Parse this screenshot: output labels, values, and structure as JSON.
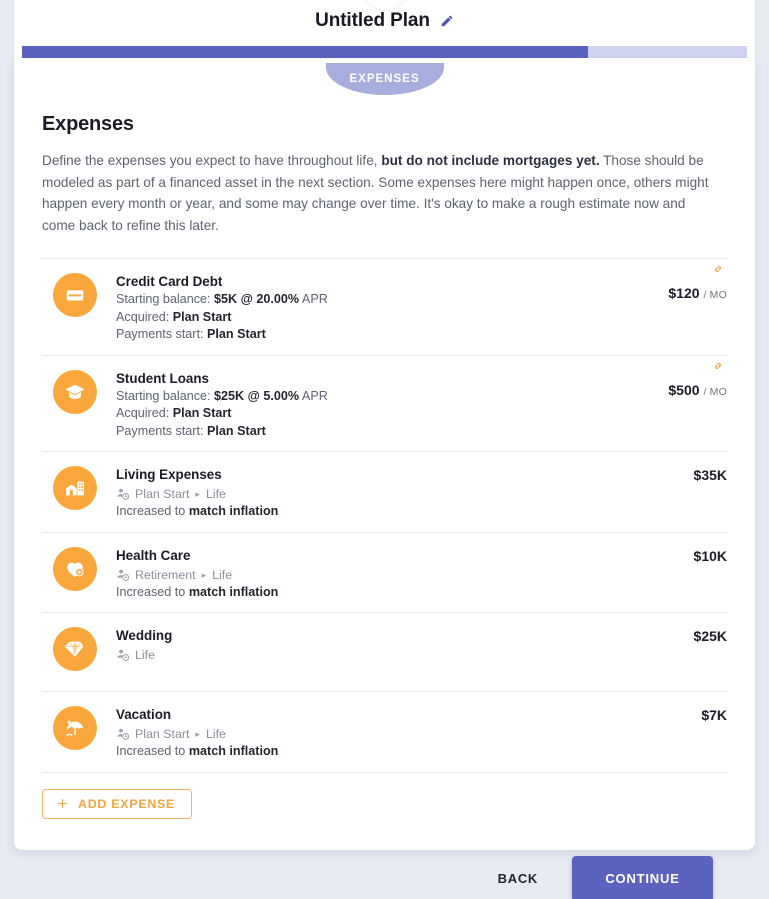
{
  "header": {
    "logo_icon": "app-logo-circle",
    "topright_icon": "window-icon",
    "plan_title": "Untitled Plan",
    "edit_icon": "pencil-icon",
    "progress_percent": 78
  },
  "tab": {
    "label": "EXPENSES"
  },
  "section": {
    "title": "Expenses",
    "desc_part1": "Define the expenses you expect to have throughout life, ",
    "desc_bold": "but do not include mortgages yet.",
    "desc_part2": " Those should be modeled as part of a financed asset in the next section. Some expenses here might happen once, others might happen every month or year, and some may change over time. It's okay to make a rough estimate now and come back to refine this later."
  },
  "expenses": [
    {
      "icon": "credit-card-icon",
      "name": "Credit Card Debt",
      "balance_label": "Starting balance: ",
      "balance_value": "$5K @ 20.00%",
      "balance_suffix": " APR",
      "acquired_label": "Acquired: ",
      "acquired_value": "Plan Start",
      "payments_label": "Payments start: ",
      "payments_value": "Plan Start",
      "amount": "$120",
      "per": "/ MO",
      "link_icon": "link-icon"
    },
    {
      "icon": "graduation-cap-icon",
      "name": "Student Loans",
      "balance_label": "Starting balance: ",
      "balance_value": "$25K @ 5.00%",
      "balance_suffix": " APR",
      "acquired_label": "Acquired: ",
      "acquired_value": "Plan Start",
      "payments_label": "Payments start: ",
      "payments_value": "Plan Start",
      "amount": "$500",
      "per": "/ MO",
      "link_icon": "link-icon"
    },
    {
      "icon": "house-building-icon",
      "name": "Living Expenses",
      "tag_icon": "person-clock-icon",
      "tag_start": "Plan Start",
      "tag_sep": "▸",
      "tag_end": "Life",
      "growth_label": "Increased to ",
      "growth_value": "match inflation",
      "amount": "$35K"
    },
    {
      "icon": "heart-plus-icon",
      "name": "Health Care",
      "tag_icon": "person-clock-icon",
      "tag_start": "Retirement",
      "tag_sep": "▸",
      "tag_end": "Life",
      "growth_label": "Increased to ",
      "growth_value": "match inflation",
      "amount": "$10K"
    },
    {
      "icon": "diamond-icon",
      "name": "Wedding",
      "tag_icon": "person-clock-icon",
      "tag_start": "Life",
      "amount": "$25K"
    },
    {
      "icon": "beach-umbrella-icon",
      "name": "Vacation",
      "tag_icon": "person-clock-icon",
      "tag_start": "Plan Start",
      "tag_sep": "▸",
      "tag_end": "Life",
      "growth_label": "Increased to ",
      "growth_value": "match inflation",
      "amount": "$7K"
    }
  ],
  "add_expense": {
    "label": "ADD EXPENSE",
    "icon": "plus-icon"
  },
  "footer": {
    "back_label": "BACK",
    "continue_label": "CONTINUE"
  },
  "colors": {
    "accent_orange": "#f9a63c",
    "accent_purple": "#5c63bf",
    "tab_purple": "#a7addc",
    "progress_track": "#cfd3ef"
  }
}
